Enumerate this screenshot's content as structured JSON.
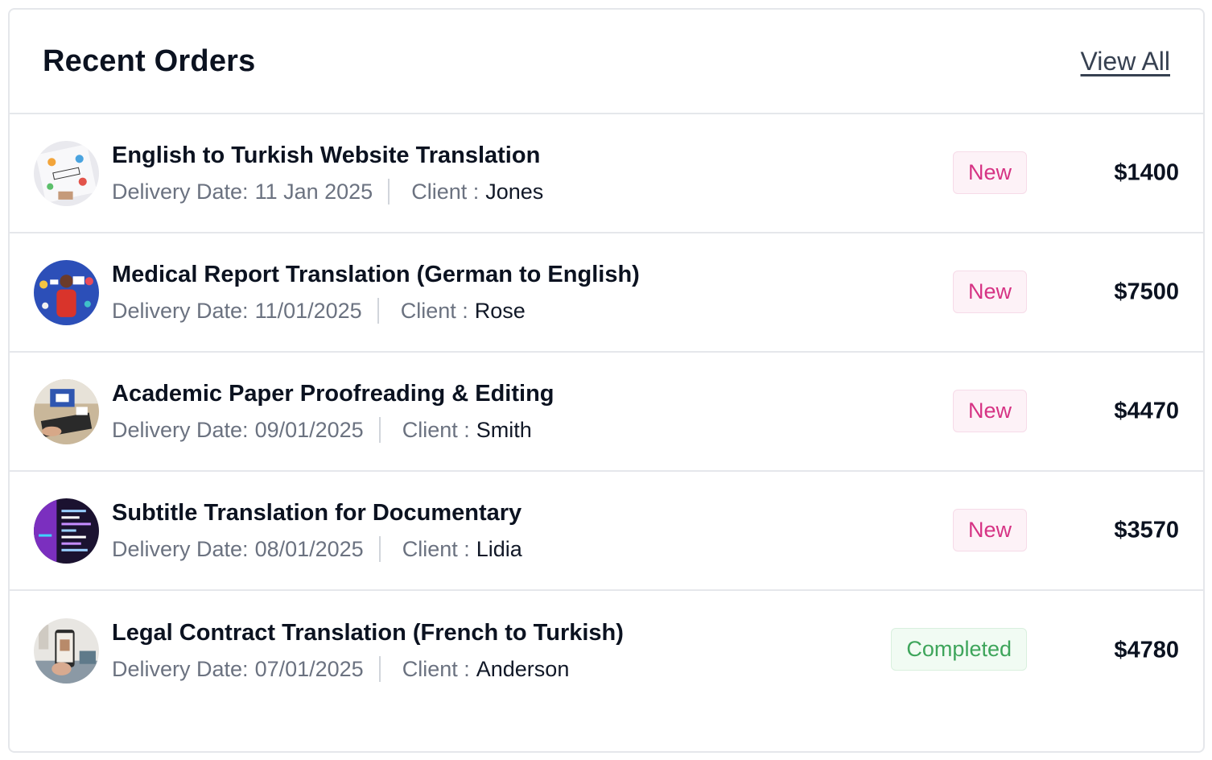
{
  "header": {
    "title": "Recent Orders",
    "view_all": "View All"
  },
  "labels": {
    "delivery_prefix": "Delivery Date:",
    "client_prefix": "Client :"
  },
  "orders": [
    {
      "title": "English to Turkish Website Translation",
      "delivery": "11 Jan 2025",
      "client": "Jones",
      "status": "New",
      "price": "$1400",
      "thumb_icon": "advertising-sketch-image"
    },
    {
      "title": "Medical Report Translation (German to English)",
      "delivery": "11/01/2025",
      "client": "Rose",
      "status": "New",
      "price": "$7500",
      "thumb_icon": "woman-megaphone-image"
    },
    {
      "title": "Academic Paper Proofreading & Editing",
      "delivery": "09/01/2025",
      "client": "Smith",
      "status": "New",
      "price": "$4470",
      "thumb_icon": "laptop-email-image"
    },
    {
      "title": "Subtitle Translation for Documentary",
      "delivery": "08/01/2025",
      "client": "Lidia",
      "status": "New",
      "price": "$3570",
      "thumb_icon": "code-screen-image"
    },
    {
      "title": "Legal Contract Translation (French to Turkish)",
      "delivery": "07/01/2025",
      "client": "Anderson",
      "status": "Completed",
      "price": "$4780",
      "thumb_icon": "phone-room-image"
    }
  ],
  "colors": {
    "status_new": "#d63384",
    "status_completed": "#3ea55b",
    "border": "#e5e7eb"
  }
}
